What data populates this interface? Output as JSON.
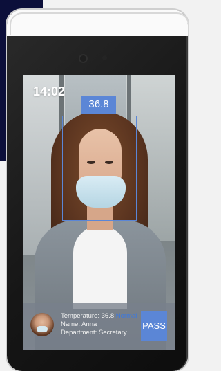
{
  "screen": {
    "clock": "14:02",
    "detection": {
      "temperature_tag": "36.8"
    },
    "info_panel": {
      "temperature_label": "Temperature:",
      "temperature_value": "36.8",
      "status": "Normal",
      "name_label": "Name:",
      "name_value": "Anna",
      "department_label": "Department:",
      "department_value": "Secretary",
      "pass_label": "PASS"
    }
  },
  "colors": {
    "accent": "#5b86d6",
    "status_normal": "#3b78e0",
    "background_navy": "#0c0f3a"
  }
}
